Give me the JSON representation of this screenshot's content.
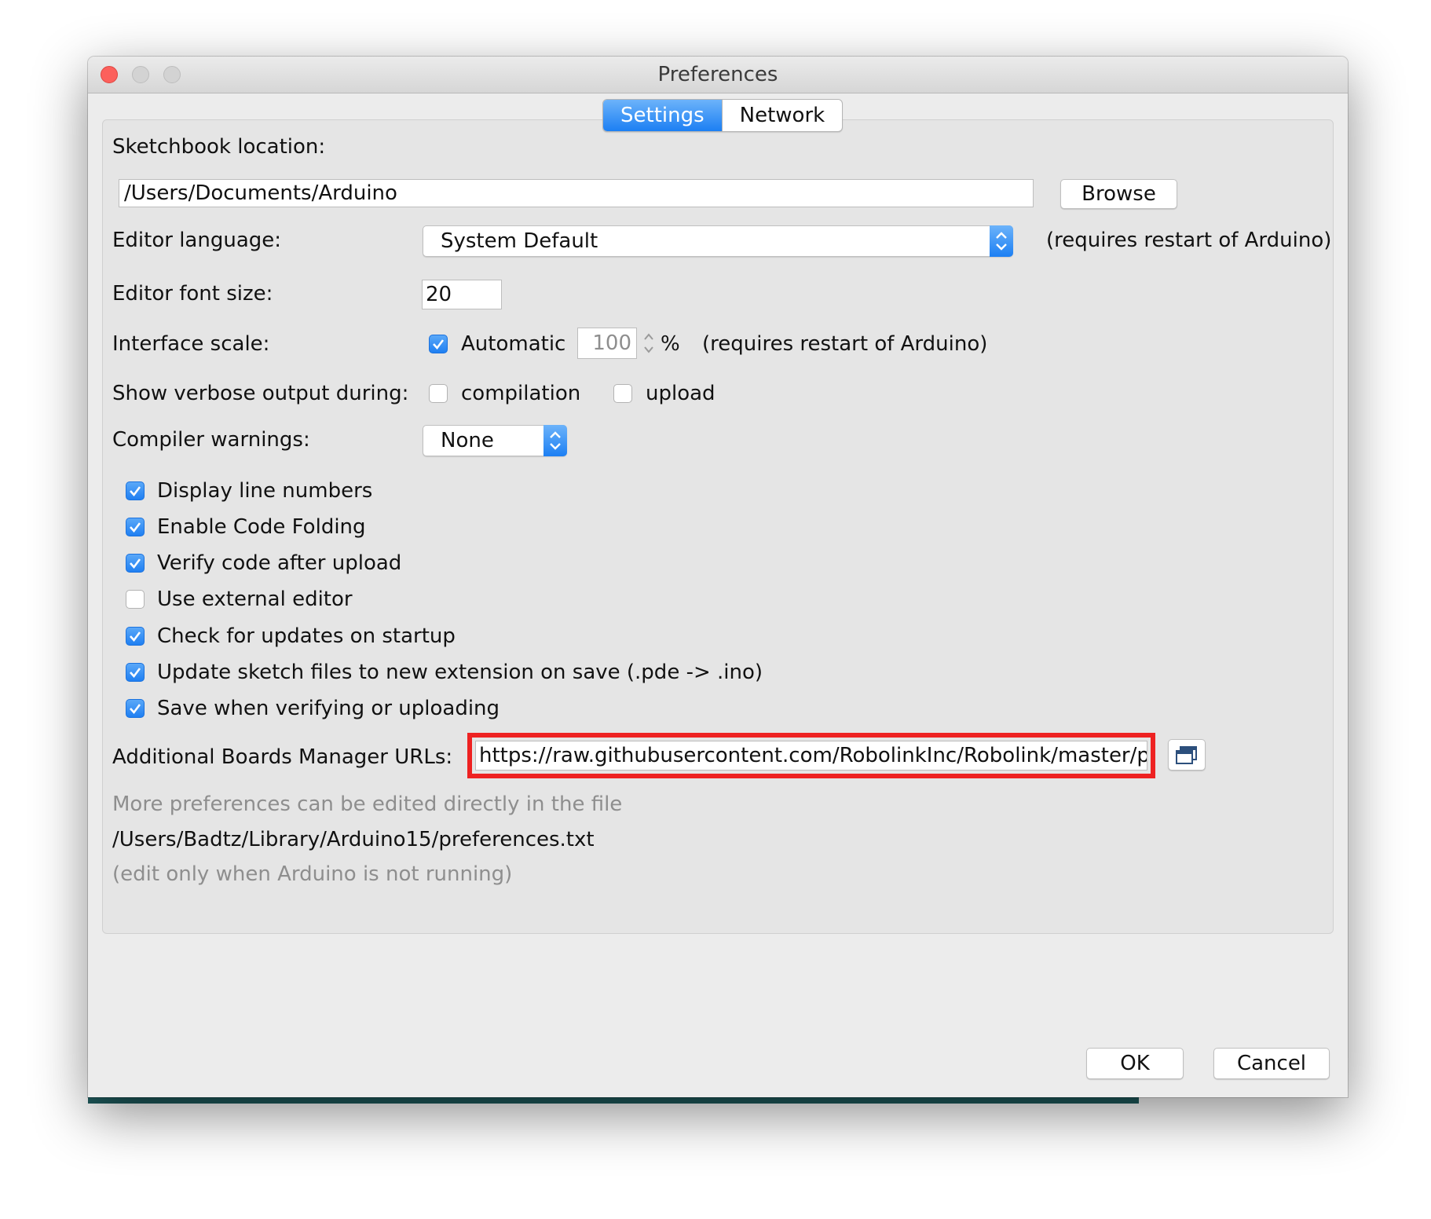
{
  "window": {
    "title": "Preferences"
  },
  "tabs": [
    {
      "label": "Settings",
      "active": true
    },
    {
      "label": "Network",
      "active": false
    }
  ],
  "sketchbook": {
    "label": "Sketchbook location:",
    "value": "/Users/Documents/Arduino",
    "browse_label": "Browse"
  },
  "editor_language": {
    "label": "Editor language:",
    "selected": "System Default",
    "note": "(requires restart of Arduino)"
  },
  "font_size": {
    "label": "Editor font size:",
    "value": "20"
  },
  "interface_scale": {
    "label": "Interface scale:",
    "automatic_label": "Automatic",
    "automatic_checked": true,
    "value": "100",
    "unit": "%",
    "note": "(requires restart of Arduino)"
  },
  "verbose": {
    "label": "Show verbose output during:",
    "compilation_label": "compilation",
    "compilation_checked": false,
    "upload_label": "upload",
    "upload_checked": false
  },
  "compiler_warnings": {
    "label": "Compiler warnings:",
    "selected": "None"
  },
  "options": [
    {
      "label": "Display line numbers",
      "checked": true
    },
    {
      "label": "Enable Code Folding",
      "checked": true
    },
    {
      "label": "Verify code after upload",
      "checked": true
    },
    {
      "label": "Use external editor",
      "checked": false
    },
    {
      "label": "Check for updates on startup",
      "checked": true
    },
    {
      "label": "Update sketch files to new extension on save (.pde -> .ino)",
      "checked": true
    },
    {
      "label": "Save when verifying or uploading",
      "checked": true
    }
  ],
  "boards_urls": {
    "label": "Additional Boards Manager URLs:",
    "value": "https://raw.githubusercontent.com/RobolinkInc/Robolink/master/package_r",
    "open_icon": "window-list-icon"
  },
  "footer_info": {
    "line1": "More preferences can be edited directly in the file",
    "line2": "/Users/Badtz/Library/Arduino15/preferences.txt",
    "line3": "(edit only when Arduino is not running)"
  },
  "buttons": {
    "ok_label": "OK",
    "cancel_label": "Cancel"
  },
  "colors": {
    "accent": "#1c7ff3",
    "highlight_box": "#ee2222"
  }
}
